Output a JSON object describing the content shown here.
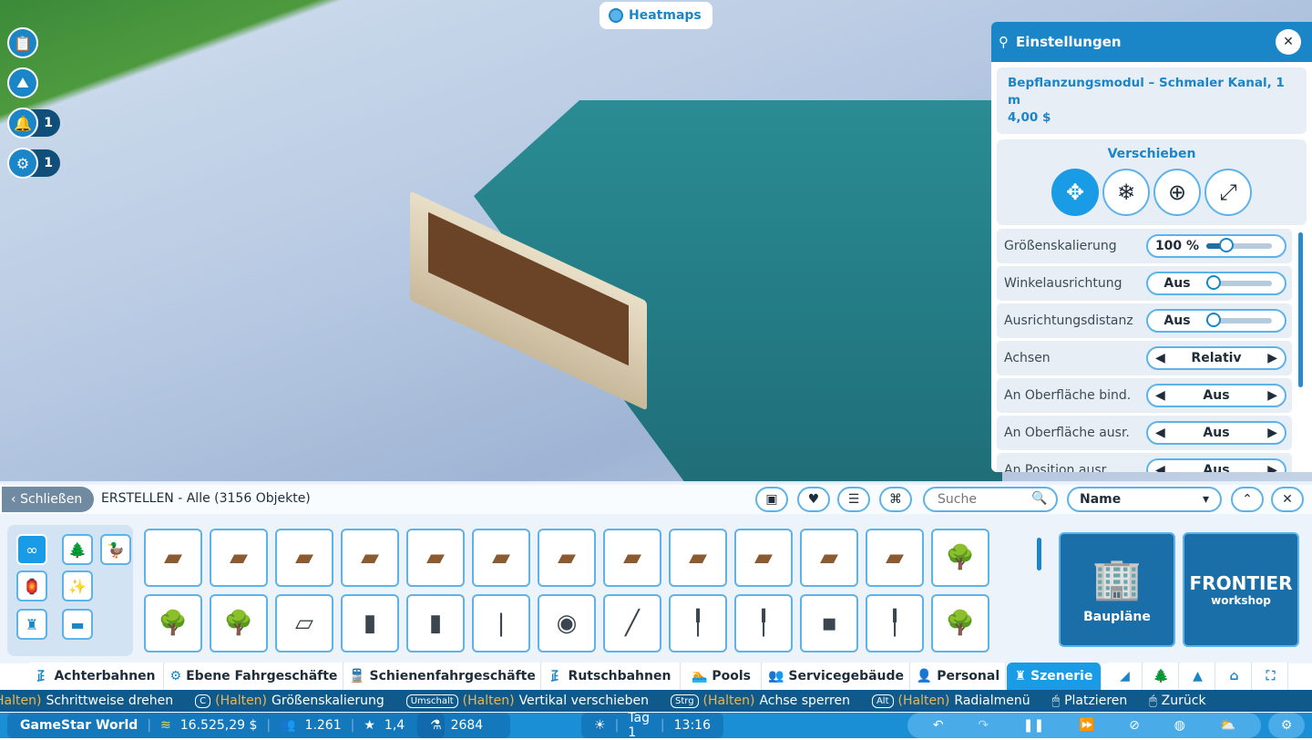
{
  "heatmaps": {
    "label": "Heatmaps"
  },
  "left_buttons": [
    {
      "icon": "clipboard-icon"
    },
    {
      "icon": "terrain-add-icon"
    },
    {
      "icon": "bell-icon",
      "count": "1"
    },
    {
      "icon": "gear-badge-icon",
      "count": "1"
    }
  ],
  "settings": {
    "title": "Einstellungen",
    "object_name": "Bepflanzungsmodul – Schmaler Kanal, 1 m",
    "price": "4,00 $",
    "move_title": "Verschieben",
    "move_modes": [
      {
        "icon": "move-arrows-icon",
        "active": true
      },
      {
        "icon": "snowflake-icon"
      },
      {
        "icon": "orbit-icon"
      },
      {
        "icon": "resize-icon"
      }
    ],
    "rows": [
      {
        "label": "Größenskalierung",
        "type": "slider",
        "value": "100 %",
        "level": 0.2
      },
      {
        "label": "Winkelausrichtung",
        "type": "slider",
        "value": "Aus",
        "level": 0
      },
      {
        "label": "Ausrichtungsdistanz",
        "type": "slider",
        "value": "Aus",
        "level": 0
      },
      {
        "label": "Achsen",
        "type": "select",
        "value": "Relativ"
      },
      {
        "label": "An Oberfläche bind.",
        "type": "select",
        "value": "Aus"
      },
      {
        "label": "An Oberfläche ausr.",
        "type": "select",
        "value": "Aus"
      },
      {
        "label": "An Position ausr.",
        "type": "select",
        "value": "Aus"
      }
    ]
  },
  "browser": {
    "close_label": "Schließen",
    "title": "ERSTELLEN - Alle (3156 Objekte)",
    "search_placeholder": "Suche",
    "sort_value": "Name",
    "filters": [
      "blueprint-filter-icon",
      "heart-icon",
      "sliders-icon",
      "bundle-icon"
    ],
    "categories": [
      {
        "icon": "infinity-icon",
        "glyph": "∞",
        "active": true
      },
      {
        "icon": "tree-icon",
        "glyph": "🌲"
      },
      {
        "icon": "duck-icon",
        "glyph": "🦆"
      },
      {
        "icon": "lamp-icon",
        "glyph": "🏮"
      },
      {
        "icon": "fireworks-icon",
        "glyph": "✨"
      },
      {
        "icon": "tower-icon",
        "glyph": "♜"
      },
      {
        "icon": "bench-icon",
        "glyph": "▬"
      }
    ],
    "items": [
      [
        "planter-round",
        "planter-corner",
        "planter-square",
        "planter-curve",
        "planter-wood",
        "planter-edge",
        "planter-edge-2",
        "planter-edge-3",
        "planter-corner-2",
        "planter-end",
        "planter-narrow",
        "planter-triangle",
        "shrub"
      ],
      [
        "tree",
        "tree-2",
        "sign-board",
        "pillar-round",
        "pillar-thin",
        "pole",
        "drone-statue",
        "rail-lamp",
        "lamp-post",
        "lamp-short",
        "wall-light",
        "lamp-tall",
        "bush"
      ]
    ],
    "blueprints_label": "Baupläne",
    "workshop_label": "FRONTIER",
    "workshop_sub": "workshop"
  },
  "tabs": [
    {
      "label": "Achterbahnen",
      "icon": "coaster-icon",
      "glyph": "⺪"
    },
    {
      "label": "Ebene Fahrgeschäfte",
      "icon": "ferris-wheel-icon",
      "glyph": "⚙"
    },
    {
      "label": "Schienenfahrgeschäfte",
      "icon": "train-icon",
      "glyph": "🚆"
    },
    {
      "label": "Rutschbahnen",
      "icon": "slide-icon",
      "glyph": "⺪"
    },
    {
      "label": "Pools",
      "icon": "pool-icon",
      "glyph": "🏊"
    },
    {
      "label": "Servicegebäude",
      "icon": "people-icon",
      "glyph": "👥"
    },
    {
      "label": "Personal",
      "icon": "staff-icon",
      "glyph": "👤"
    },
    {
      "label": "Szenerie",
      "icon": "tower-icon",
      "glyph": "♜",
      "active": true
    }
  ],
  "tab_tools": [
    "terrain-icon",
    "tree-icon",
    "mountain-icon",
    "building-icon",
    "expand-icon"
  ],
  "hints": [
    {
      "key": "",
      "hold": "Halten)",
      "text": "Schrittweise drehen"
    },
    {
      "key": "C",
      "hold": "(Halten)",
      "text": "Größenskalierung"
    },
    {
      "key": "Umschalt",
      "hold": "(Halten)",
      "text": "Vertikal verschieben"
    },
    {
      "key": "Strg",
      "hold": "(Halten)",
      "text": "Achse sperren"
    },
    {
      "key": "Alt",
      "hold": "(Halten)",
      "text": "Radialmenü"
    },
    {
      "key": "mouse-left",
      "hold": "",
      "text": "Platzieren"
    },
    {
      "key": "mouse-right",
      "hold": "",
      "text": "Zurück"
    }
  ],
  "status": {
    "park": "GameStar World",
    "money": "16.525,29 $",
    "guests": "1.261",
    "rating": "1,4",
    "research": "2684",
    "day": "Tag 1",
    "time": "13:16"
  },
  "colors": {
    "accent": "#1a86c8",
    "hint_bar": "#0f5a8a",
    "status_bar": "#1b8fd6",
    "hold_text": "#f0b54a"
  }
}
